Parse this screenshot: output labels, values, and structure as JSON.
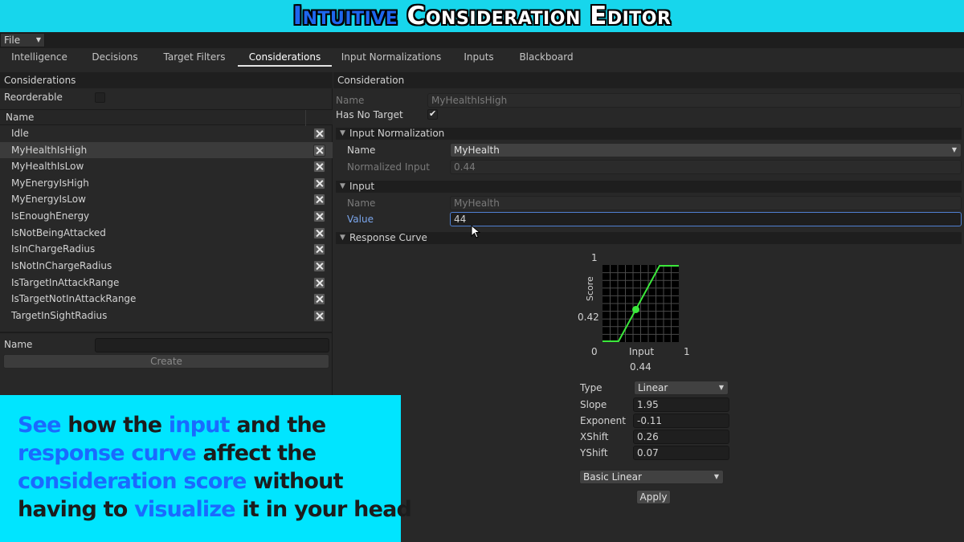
{
  "banner": {
    "title_highlight": "Intuitive",
    "title_rest": "Consideration Editor"
  },
  "menu": {
    "file_label": "File"
  },
  "tabs": [
    {
      "label": "Intelligence"
    },
    {
      "label": "Decisions"
    },
    {
      "label": "Target Filters"
    },
    {
      "label": "Considerations",
      "active": true
    },
    {
      "label": "Input Normalizations"
    },
    {
      "label": "Inputs"
    },
    {
      "label": "Blackboard"
    }
  ],
  "left": {
    "title": "Considerations",
    "reorderable_label": "Reorderable",
    "reorderable_checked": false,
    "list_header": "Name",
    "items": [
      {
        "label": "Idle"
      },
      {
        "label": "MyHealthIsHigh",
        "selected": true
      },
      {
        "label": "MyHealthIsLow"
      },
      {
        "label": "MyEnergyIsHigh"
      },
      {
        "label": "MyEnergyIsLow"
      },
      {
        "label": "IsEnoughEnergy"
      },
      {
        "label": "IsNotBeingAttacked"
      },
      {
        "label": "IsInChargeRadius"
      },
      {
        "label": "IsNotInChargeRadius"
      },
      {
        "label": "IsTargetInAttackRange"
      },
      {
        "label": "IsTargetNotInAttackRange"
      },
      {
        "label": "TargetInSightRadius"
      }
    ],
    "name_label": "Name",
    "name_value": "",
    "create_label": "Create"
  },
  "right": {
    "title": "Consideration",
    "name_label": "Name",
    "name_value": "MyHealthIsHigh",
    "has_no_target_label": "Has No Target",
    "has_no_target_checked": true,
    "check_glyph": "✔",
    "input_normalization": {
      "section": "Input Normalization",
      "name_label": "Name",
      "name_value": "MyHealth",
      "normalized_label": "Normalized Input",
      "normalized_value": "0.44"
    },
    "input": {
      "section": "Input",
      "name_label": "Name",
      "name_value": "MyHealth",
      "value_label": "Value",
      "value_value": "44"
    },
    "response_curve": {
      "section": "Response Curve",
      "y_max_label": "1",
      "y_axis_label": "Score",
      "score_value": "0.42",
      "x_min_label": "0",
      "x_axis_label": "Input",
      "x_max_label": "1",
      "input_value": "0.44",
      "curve_color": "#3be83b",
      "type_label": "Type",
      "type_value": "Linear",
      "slope_label": "Slope",
      "slope_value": "1.95",
      "exponent_label": "Exponent",
      "exponent_value": "-0.11",
      "xshift_label": "XShift",
      "xshift_value": "0.26",
      "yshift_label": "YShift",
      "yshift_value": "0.07",
      "preset_value": "Basic Linear",
      "apply_label": "Apply"
    }
  },
  "info": {
    "line1": [
      {
        "t": "See",
        "hl": true
      },
      {
        "t": " how the ",
        "hl": false
      },
      {
        "t": "input",
        "hl": true
      },
      {
        "t": " and the",
        "hl": false
      }
    ],
    "line2": [
      {
        "t": "response curve",
        "hl": true
      },
      {
        "t": " affect the",
        "hl": false
      }
    ],
    "line3": [
      {
        "t": "consideration score",
        "hl": true
      },
      {
        "t": " without",
        "hl": false
      }
    ],
    "line4": [
      {
        "t": "having to ",
        "hl": false
      },
      {
        "t": "visualize",
        "hl": true
      },
      {
        "t": " it in your head",
        "hl": false
      }
    ]
  },
  "colors": {
    "banner": "#17d6ec",
    "info_bg": "#00e5ff",
    "highlight": "#1a6aff",
    "curve": "#3be83b"
  }
}
